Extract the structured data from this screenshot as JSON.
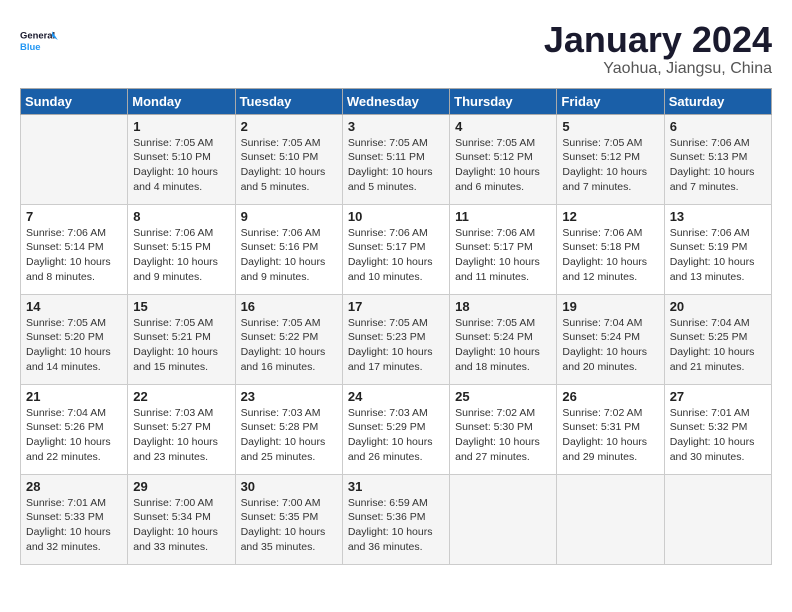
{
  "logo": {
    "text_general": "General",
    "text_blue": "Blue"
  },
  "title": "January 2024",
  "subtitle": "Yaohua, Jiangsu, China",
  "headers": [
    "Sunday",
    "Monday",
    "Tuesday",
    "Wednesday",
    "Thursday",
    "Friday",
    "Saturday"
  ],
  "weeks": [
    [
      {
        "day": "",
        "info": ""
      },
      {
        "day": "1",
        "info": "Sunrise: 7:05 AM\nSunset: 5:10 PM\nDaylight: 10 hours\nand 4 minutes."
      },
      {
        "day": "2",
        "info": "Sunrise: 7:05 AM\nSunset: 5:10 PM\nDaylight: 10 hours\nand 5 minutes."
      },
      {
        "day": "3",
        "info": "Sunrise: 7:05 AM\nSunset: 5:11 PM\nDaylight: 10 hours\nand 5 minutes."
      },
      {
        "day": "4",
        "info": "Sunrise: 7:05 AM\nSunset: 5:12 PM\nDaylight: 10 hours\nand 6 minutes."
      },
      {
        "day": "5",
        "info": "Sunrise: 7:05 AM\nSunset: 5:12 PM\nDaylight: 10 hours\nand 7 minutes."
      },
      {
        "day": "6",
        "info": "Sunrise: 7:06 AM\nSunset: 5:13 PM\nDaylight: 10 hours\nand 7 minutes."
      }
    ],
    [
      {
        "day": "7",
        "info": "Sunrise: 7:06 AM\nSunset: 5:14 PM\nDaylight: 10 hours\nand 8 minutes."
      },
      {
        "day": "8",
        "info": "Sunrise: 7:06 AM\nSunset: 5:15 PM\nDaylight: 10 hours\nand 9 minutes."
      },
      {
        "day": "9",
        "info": "Sunrise: 7:06 AM\nSunset: 5:16 PM\nDaylight: 10 hours\nand 9 minutes."
      },
      {
        "day": "10",
        "info": "Sunrise: 7:06 AM\nSunset: 5:17 PM\nDaylight: 10 hours\nand 10 minutes."
      },
      {
        "day": "11",
        "info": "Sunrise: 7:06 AM\nSunset: 5:17 PM\nDaylight: 10 hours\nand 11 minutes."
      },
      {
        "day": "12",
        "info": "Sunrise: 7:06 AM\nSunset: 5:18 PM\nDaylight: 10 hours\nand 12 minutes."
      },
      {
        "day": "13",
        "info": "Sunrise: 7:06 AM\nSunset: 5:19 PM\nDaylight: 10 hours\nand 13 minutes."
      }
    ],
    [
      {
        "day": "14",
        "info": "Sunrise: 7:05 AM\nSunset: 5:20 PM\nDaylight: 10 hours\nand 14 minutes."
      },
      {
        "day": "15",
        "info": "Sunrise: 7:05 AM\nSunset: 5:21 PM\nDaylight: 10 hours\nand 15 minutes."
      },
      {
        "day": "16",
        "info": "Sunrise: 7:05 AM\nSunset: 5:22 PM\nDaylight: 10 hours\nand 16 minutes."
      },
      {
        "day": "17",
        "info": "Sunrise: 7:05 AM\nSunset: 5:23 PM\nDaylight: 10 hours\nand 17 minutes."
      },
      {
        "day": "18",
        "info": "Sunrise: 7:05 AM\nSunset: 5:24 PM\nDaylight: 10 hours\nand 18 minutes."
      },
      {
        "day": "19",
        "info": "Sunrise: 7:04 AM\nSunset: 5:24 PM\nDaylight: 10 hours\nand 20 minutes."
      },
      {
        "day": "20",
        "info": "Sunrise: 7:04 AM\nSunset: 5:25 PM\nDaylight: 10 hours\nand 21 minutes."
      }
    ],
    [
      {
        "day": "21",
        "info": "Sunrise: 7:04 AM\nSunset: 5:26 PM\nDaylight: 10 hours\nand 22 minutes."
      },
      {
        "day": "22",
        "info": "Sunrise: 7:03 AM\nSunset: 5:27 PM\nDaylight: 10 hours\nand 23 minutes."
      },
      {
        "day": "23",
        "info": "Sunrise: 7:03 AM\nSunset: 5:28 PM\nDaylight: 10 hours\nand 25 minutes."
      },
      {
        "day": "24",
        "info": "Sunrise: 7:03 AM\nSunset: 5:29 PM\nDaylight: 10 hours\nand 26 minutes."
      },
      {
        "day": "25",
        "info": "Sunrise: 7:02 AM\nSunset: 5:30 PM\nDaylight: 10 hours\nand 27 minutes."
      },
      {
        "day": "26",
        "info": "Sunrise: 7:02 AM\nSunset: 5:31 PM\nDaylight: 10 hours\nand 29 minutes."
      },
      {
        "day": "27",
        "info": "Sunrise: 7:01 AM\nSunset: 5:32 PM\nDaylight: 10 hours\nand 30 minutes."
      }
    ],
    [
      {
        "day": "28",
        "info": "Sunrise: 7:01 AM\nSunset: 5:33 PM\nDaylight: 10 hours\nand 32 minutes."
      },
      {
        "day": "29",
        "info": "Sunrise: 7:00 AM\nSunset: 5:34 PM\nDaylight: 10 hours\nand 33 minutes."
      },
      {
        "day": "30",
        "info": "Sunrise: 7:00 AM\nSunset: 5:35 PM\nDaylight: 10 hours\nand 35 minutes."
      },
      {
        "day": "31",
        "info": "Sunrise: 6:59 AM\nSunset: 5:36 PM\nDaylight: 10 hours\nand 36 minutes."
      },
      {
        "day": "",
        "info": ""
      },
      {
        "day": "",
        "info": ""
      },
      {
        "day": "",
        "info": ""
      }
    ]
  ]
}
